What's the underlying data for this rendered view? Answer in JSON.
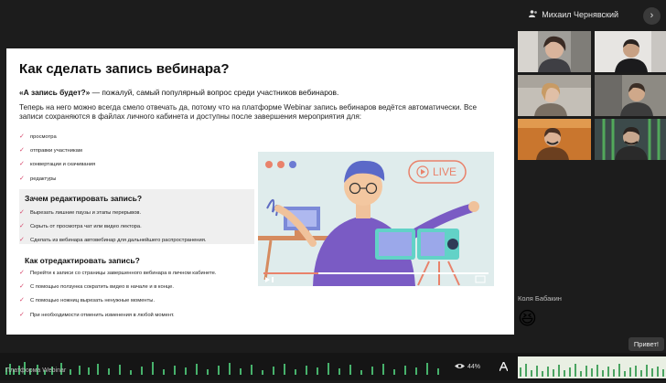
{
  "header": {
    "presenter_name": "Михаил Чернявский",
    "next_label": "›"
  },
  "slide": {
    "title": "Как сделать запись вебинара?",
    "lead_bold": "«А запись будет?»",
    "lead_rest": " — пожалуй, самый популярный вопрос среди участников вебинаров.",
    "paragraph": "Теперь на него можно всегда смело отвечать да, потому что на платформе Webinar запись вебинаров ведётся автоматически. Все записи сохраняются в файлах личного кабинета и доступны после завершения мероприятия для:",
    "uses": [
      "просмотра",
      "отправки участникам",
      "конвертации и скачивания",
      "редактуры"
    ],
    "edit_heading": "Зачем редактировать запись?",
    "edit_items": [
      "Вырезать лишние паузы и этапы перерывов.",
      "Скрыть от просмотра чат или видео лектора.",
      "Сделать из вебинара автовебинар для дальнейшего распространения."
    ],
    "how_heading": "Как отредактировать запись?",
    "how_items": [
      "Перейти к записи со страницы завершенного вебинара в личном кабинете.",
      "С помощью ползунка сократить видео в начале и в конце.",
      "С помощью ножниц вырезать ненужные моменты.",
      "При необходимости отменить изменения в любой момент."
    ],
    "live_label": "LIVE"
  },
  "participants": {
    "speaker_name": "Коля Бабакин",
    "reaction": "😆",
    "greeting": "Привет!"
  },
  "bottom_bar": {
    "caption": "Платформа Webinar",
    "views": "44%"
  },
  "colors": {
    "accent": "#d6476b",
    "slide_bg": "#ffffff",
    "illustration_bg": "#dfecec"
  }
}
